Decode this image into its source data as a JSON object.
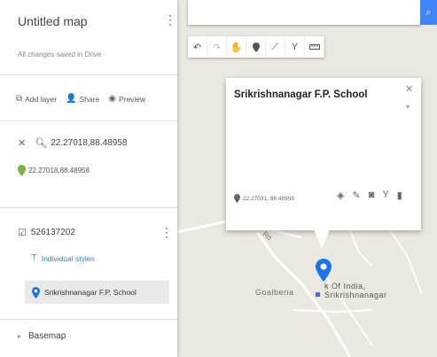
{
  "panel": {
    "title": "Untitled map",
    "status": "All changes saved in Drive",
    "menu_icon": "⋮",
    "actions": [
      {
        "icon": "add-layer-icon",
        "label": "Add layer"
      },
      {
        "icon": "share-icon",
        "label": "Share"
      },
      {
        "icon": "preview-icon",
        "label": "Preview"
      }
    ],
    "search_layer": {
      "query": "22.27018,88.48958",
      "result": "22.27018,88.48958"
    },
    "layer": {
      "title": "526137202",
      "styles_link": "Individual styles",
      "feature": "Srikrishnanagar F.P. School"
    },
    "basemap": "Basemap"
  },
  "search": {
    "value": "",
    "placeholder": ""
  },
  "toolbar": {
    "buttons": [
      "undo-icon",
      "redo-icon",
      "hand-icon",
      "marker-icon",
      "draw-line-icon",
      "route-icon",
      "ruler-icon"
    ]
  },
  "info_window": {
    "title": "Srikrishnanagar F.P. School",
    "coords": "22.27031, 88.48959",
    "tools": [
      "style-icon",
      "edit-icon",
      "camera-icon",
      "directions-icon",
      "delete-icon"
    ]
  },
  "map": {
    "labels": {
      "village": "Goalberia",
      "bank_line1": "k Of India,",
      "bank_line2": "Srikrishnanagar",
      "road": "Rd"
    }
  },
  "colors": {
    "accent_blue": "#4285f4",
    "marker_blue": "#1a73e8",
    "pin_green": "#7cb342",
    "link_blue": "#3a7bd5"
  }
}
